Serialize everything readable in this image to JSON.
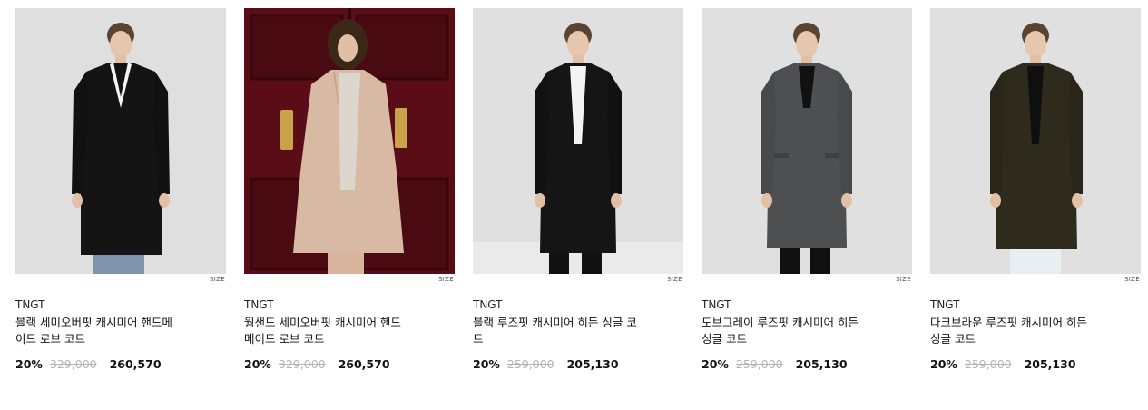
{
  "products": [
    {
      "image_icon": "product-photo-black-coat",
      "size_label": "SIZE",
      "brand": "TNGT",
      "name_line1": "블랙 세미오버핏 캐시미어 핸드메",
      "name_line2": "이드 로브 코트",
      "discount": "20%",
      "original_price": "329,000",
      "sale_price": "260,570",
      "coat_color": "#141414"
    },
    {
      "image_icon": "product-photo-oatmeal-coat",
      "size_label": "SIZE",
      "brand": "TNGT",
      "name_line1": "웜샌드 세미오버핏 캐시미어 핸드",
      "name_line2": "메이드 로브 코트",
      "discount": "20%",
      "original_price": "329,000",
      "sale_price": "260,570",
      "coat_color": "#d8b9a3"
    },
    {
      "image_icon": "product-photo-black-single-coat",
      "size_label": "SIZE",
      "brand": "TNGT",
      "name_line1": "블랙 루즈핏 캐시미어 히든 싱글 코",
      "name_line2": "트",
      "discount": "20%",
      "original_price": "259,000",
      "sale_price": "205,130",
      "coat_color": "#151515"
    },
    {
      "image_icon": "product-photo-grey-coat",
      "size_label": "SIZE",
      "brand": "TNGT",
      "name_line1": "도브그레이 루즈핏 캐시미어 히든",
      "name_line2": "싱글 코트",
      "discount": "20%",
      "original_price": "259,000",
      "sale_price": "205,130",
      "coat_color": "#4d4f50"
    },
    {
      "image_icon": "product-photo-darkbrown-coat",
      "size_label": "SIZE",
      "brand": "TNGT",
      "name_line1": "다크브라운 루즈핏 캐시미어 히든",
      "name_line2": "싱글 코트",
      "discount": "20%",
      "original_price": "259,000",
      "sale_price": "205,130",
      "coat_color": "#2f2b1c"
    }
  ]
}
